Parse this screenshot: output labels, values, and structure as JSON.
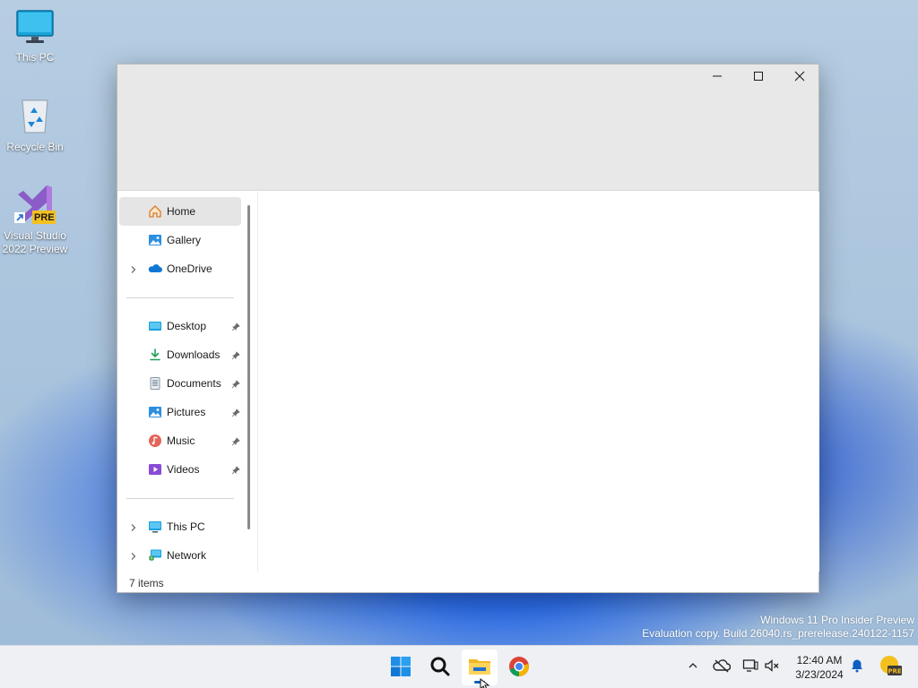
{
  "desktop": {
    "icons": [
      {
        "label": "This PC",
        "icon": "monitor-icon"
      },
      {
        "label": "Recycle Bin",
        "icon": "recycle-bin-icon"
      },
      {
        "label_line1": "Visual Studio",
        "label_line2": "2022 Preview",
        "icon": "visual-studio-preview-icon",
        "badge": "PRE"
      }
    ]
  },
  "window": {
    "controls": {
      "minimize": "minimize-icon",
      "maximize": "maximize-icon",
      "close": "close-icon"
    },
    "nav": {
      "top_items": [
        {
          "label": "Home",
          "icon": "home-icon",
          "selected": true
        },
        {
          "label": "Gallery",
          "icon": "gallery-icon"
        },
        {
          "label": "OneDrive",
          "icon": "onedrive-cloud-icon",
          "expandable": true
        }
      ],
      "quick_access": [
        {
          "label": "Desktop",
          "icon": "desktop-folder-icon",
          "pinned": true
        },
        {
          "label": "Downloads",
          "icon": "downloads-icon",
          "pinned": true
        },
        {
          "label": "Documents",
          "icon": "documents-icon",
          "pinned": true
        },
        {
          "label": "Pictures",
          "icon": "pictures-icon",
          "pinned": true
        },
        {
          "label": "Music",
          "icon": "music-icon",
          "pinned": true
        },
        {
          "label": "Videos",
          "icon": "videos-icon",
          "pinned": true
        }
      ],
      "bottom_items": [
        {
          "label": "This PC",
          "icon": "this-pc-icon",
          "expandable": true
        },
        {
          "label": "Network",
          "icon": "network-icon",
          "expandable": true
        }
      ]
    },
    "status": "7 items"
  },
  "watermark": {
    "line1": "Windows 11 Pro Insider Preview",
    "line2": "Evaluation copy. Build 26040.rs_prerelease.240122-1157"
  },
  "taskbar": {
    "apps": [
      {
        "name": "Start",
        "icon": "windows-start-icon"
      },
      {
        "name": "Search",
        "icon": "search-icon"
      },
      {
        "name": "File Explorer",
        "icon": "file-explorer-icon",
        "active": true
      },
      {
        "name": "Google Chrome",
        "icon": "chrome-icon"
      }
    ],
    "tray": [
      "chevron-up-icon",
      "cloud-offline-icon",
      "display-icon",
      "volume-muted-icon"
    ],
    "clock": {
      "time": "12:40 AM",
      "date": "3/23/2024"
    },
    "accent": "#005fb8"
  }
}
